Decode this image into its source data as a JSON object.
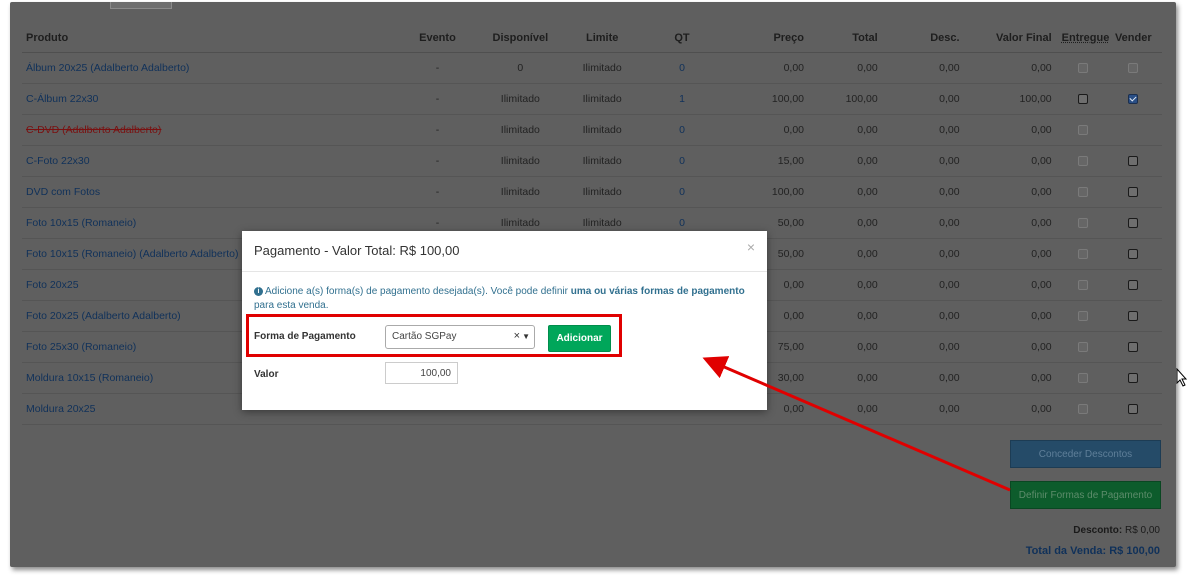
{
  "table": {
    "headers": {
      "produto": "Produto",
      "evento": "Evento",
      "disponivel": "Disponível",
      "limite": "Limite",
      "qt": "QT",
      "preco": "Preço",
      "total": "Total",
      "desc": "Desc.",
      "valor_final": "Valor Final",
      "entregue": "Entregue",
      "vender": "Vender"
    },
    "rows": [
      {
        "produto": "Álbum 20x25 (Adalberto Adalberto)",
        "evento": "-",
        "disponivel": "0",
        "limite": "Ilimitado",
        "qt": "0",
        "preco": "0,00",
        "total": "0,00",
        "desc": "0,00",
        "valor_final": "0,00",
        "entregue": "disabled",
        "vender": "disabled",
        "strike": false
      },
      {
        "produto": "C-Álbum 22x30",
        "evento": "-",
        "disponivel": "Ilimitado",
        "limite": "Ilimitado",
        "qt": "1",
        "preco": "100,00",
        "total": "100,00",
        "desc": "0,00",
        "valor_final": "100,00",
        "entregue": "unchecked",
        "vender": "checked",
        "strike": false
      },
      {
        "produto": "C-DVD (Adalberto Adalberto)",
        "evento": "-",
        "disponivel": "Ilimitado",
        "limite": "Ilimitado",
        "qt": "0",
        "preco": "0,00",
        "total": "0,00",
        "desc": "0,00",
        "valor_final": "0,00",
        "entregue": "disabled",
        "vender": "none",
        "strike": true
      },
      {
        "produto": "C-Foto 22x30",
        "evento": "-",
        "disponivel": "Ilimitado",
        "limite": "Ilimitado",
        "qt": "0",
        "preco": "15,00",
        "total": "0,00",
        "desc": "0,00",
        "valor_final": "0,00",
        "entregue": "disabled",
        "vender": "unchecked",
        "strike": false
      },
      {
        "produto": "DVD com Fotos",
        "evento": "-",
        "disponivel": "Ilimitado",
        "limite": "Ilimitado",
        "qt": "0",
        "preco": "100,00",
        "total": "0,00",
        "desc": "0,00",
        "valor_final": "0,00",
        "entregue": "disabled",
        "vender": "unchecked",
        "strike": false
      },
      {
        "produto": "Foto 10x15 (Romaneio)",
        "evento": "-",
        "disponivel": "Ilimitado",
        "limite": "Ilimitado",
        "qt": "0",
        "preco": "50,00",
        "total": "0,00",
        "desc": "0,00",
        "valor_final": "0,00",
        "entregue": "disabled",
        "vender": "unchecked",
        "strike": false
      },
      {
        "produto": "Foto 10x15 (Romaneio) (Adalberto Adalberto)",
        "evento": "",
        "disponivel": "",
        "limite": "",
        "qt": "",
        "preco": "50,00",
        "total": "0,00",
        "desc": "0,00",
        "valor_final": "0,00",
        "entregue": "disabled",
        "vender": "unchecked",
        "strike": false
      },
      {
        "produto": "Foto 20x25",
        "evento": "",
        "disponivel": "",
        "limite": "",
        "qt": "",
        "preco": "0,00",
        "total": "0,00",
        "desc": "0,00",
        "valor_final": "0,00",
        "entregue": "disabled",
        "vender": "unchecked",
        "strike": false
      },
      {
        "produto": "Foto 20x25 (Adalberto Adalberto)",
        "evento": "",
        "disponivel": "",
        "limite": "",
        "qt": "",
        "preco": "0,00",
        "total": "0,00",
        "desc": "0,00",
        "valor_final": "0,00",
        "entregue": "disabled",
        "vender": "unchecked",
        "strike": false
      },
      {
        "produto": "Foto 25x30 (Romaneio)",
        "evento": "",
        "disponivel": "",
        "limite": "",
        "qt": "",
        "preco": "75,00",
        "total": "0,00",
        "desc": "0,00",
        "valor_final": "0,00",
        "entregue": "disabled",
        "vender": "unchecked",
        "strike": false
      },
      {
        "produto": "Moldura 10x15 (Romaneio)",
        "evento": "",
        "disponivel": "",
        "limite": "",
        "qt": "",
        "preco": "30,00",
        "total": "0,00",
        "desc": "0,00",
        "valor_final": "0,00",
        "entregue": "disabled",
        "vender": "unchecked",
        "strike": false
      },
      {
        "produto": "Moldura 20x25",
        "evento": "",
        "disponivel": "",
        "limite": "",
        "qt": "",
        "preco": "0,00",
        "total": "0,00",
        "desc": "0,00",
        "valor_final": "0,00",
        "entregue": "disabled",
        "vender": "unchecked",
        "strike": false
      }
    ]
  },
  "actions": {
    "conceder_descontos": "Conceder Descontos",
    "definir_formas": "Definir Formas de Pagamento"
  },
  "summary": {
    "desconto_label": "Desconto:",
    "desconto_value": "R$ 0,00",
    "total_label": "Total da Venda:",
    "total_value": "R$ 100,00"
  },
  "modal": {
    "title": "Pagamento - Valor Total: R$ 100,00",
    "close": "×",
    "info_pre": "Adicione a(s) forma(s) de pagamento desejada(s). Você pode definir ",
    "info_bold": "uma ou várias formas de pagamento",
    "info_post": " para esta venda.",
    "forma_label": "Forma de Pagamento",
    "forma_selected": "Cartão SGPay",
    "select_clear": "×",
    "select_arrow": "▼",
    "add_button": "Adicionar",
    "valor_label": "Valor",
    "valor_value": "100,00"
  },
  "annotation": {
    "highlight_color": "#e00000"
  },
  "colors": {
    "backdrop": "#5f5f5f",
    "link": "#10315a",
    "add_button": "#00a65a",
    "discount_button": "#254b68",
    "payment_button": "#0d5c2c"
  }
}
